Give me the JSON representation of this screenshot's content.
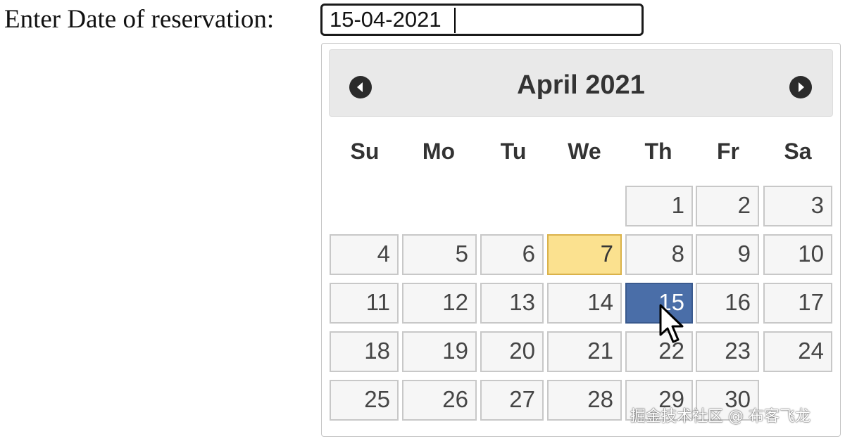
{
  "form": {
    "label": "Enter Date of reservation:",
    "date_value": "15-04-2021"
  },
  "datepicker": {
    "title": "April 2021",
    "prev_icon": "circle-triangle-left-icon",
    "next_icon": "circle-triangle-right-icon",
    "weekdays": [
      "Su",
      "Mo",
      "Tu",
      "We",
      "Th",
      "Fr",
      "Sa"
    ],
    "days": [
      {
        "label": "1"
      },
      {
        "label": "2"
      },
      {
        "label": "3"
      },
      {
        "label": "4"
      },
      {
        "label": "5"
      },
      {
        "label": "6"
      },
      {
        "label": "7",
        "state": "today"
      },
      {
        "label": "8"
      },
      {
        "label": "9"
      },
      {
        "label": "10"
      },
      {
        "label": "11"
      },
      {
        "label": "12"
      },
      {
        "label": "13"
      },
      {
        "label": "14"
      },
      {
        "label": "15",
        "state": "selected"
      },
      {
        "label": "16"
      },
      {
        "label": "17"
      },
      {
        "label": "18"
      },
      {
        "label": "19"
      },
      {
        "label": "20"
      },
      {
        "label": "21"
      },
      {
        "label": "22"
      },
      {
        "label": "23"
      },
      {
        "label": "24"
      },
      {
        "label": "25"
      },
      {
        "label": "26"
      },
      {
        "label": "27"
      },
      {
        "label": "28"
      },
      {
        "label": "29"
      },
      {
        "label": "30"
      }
    ],
    "colors": {
      "today_bg": "#fbe18f",
      "selected_bg": "#4a6ea8"
    }
  },
  "overlay": {
    "cursor_icon": "mouse-pointer-icon",
    "watermark": "掘金技术社区 @ 布客飞龙"
  }
}
